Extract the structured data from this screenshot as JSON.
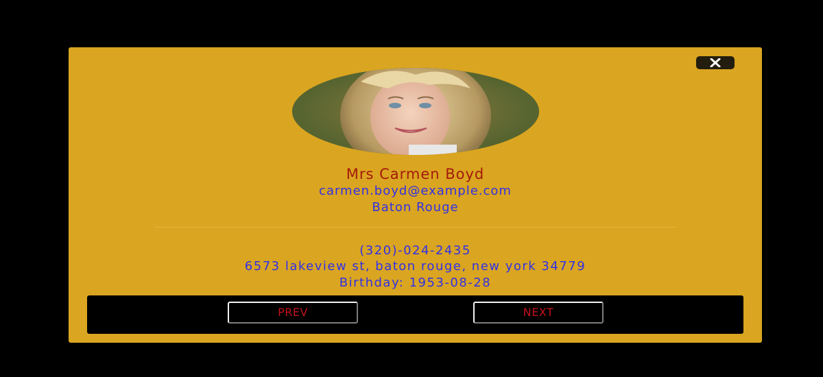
{
  "close_button": {
    "icon": "close-icon",
    "label": "×"
  },
  "profile": {
    "avatar_alt": "Carmen Boyd profile photo",
    "name": "Mrs Carmen Boyd",
    "email": "carmen.boyd@example.com",
    "city": "Baton Rouge",
    "phone": "(320)-024-2435",
    "address": "6573 lakeview st, baton rouge, new york 34779",
    "birthday": "Birthday: 1953-08-28"
  },
  "navigation": {
    "prev_label": "PREV",
    "next_label": "NEXT"
  },
  "colors": {
    "card_background": "#daa520",
    "name_text": "#a31a0c",
    "info_text": "#3131e6",
    "button_text": "#c2131a",
    "footer_background": "#000000"
  }
}
